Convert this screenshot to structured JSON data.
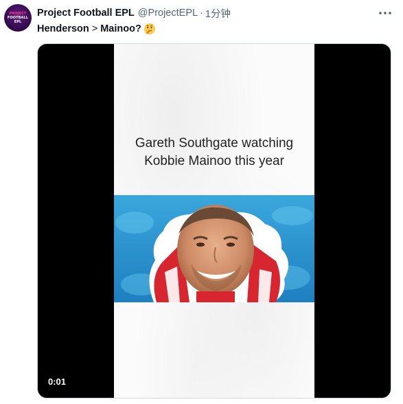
{
  "author": {
    "avatar_text": [
      "PROJECT",
      "FOOTBALL",
      "EPL"
    ],
    "display_name": "Project Football EPL",
    "handle": "@ProjectEPL",
    "separator": "·",
    "timestamp": "1分钟"
  },
  "tweet": {
    "text_part1": "Henderson",
    "text_sep": ">",
    "text_part2": "Mainoo?",
    "emoji": "thinking-face-icon"
  },
  "media": {
    "caption_line1": "Gareth Southgate watching",
    "caption_line2": "Kobbie Mainoo this year",
    "duration": "0:01"
  },
  "colors": {
    "text_primary": "#0f1419",
    "text_secondary": "#536471",
    "media_border": "#cfd9de",
    "avatar_bg": "#3a0d55",
    "avatar_accent": "#ff3c8e"
  }
}
